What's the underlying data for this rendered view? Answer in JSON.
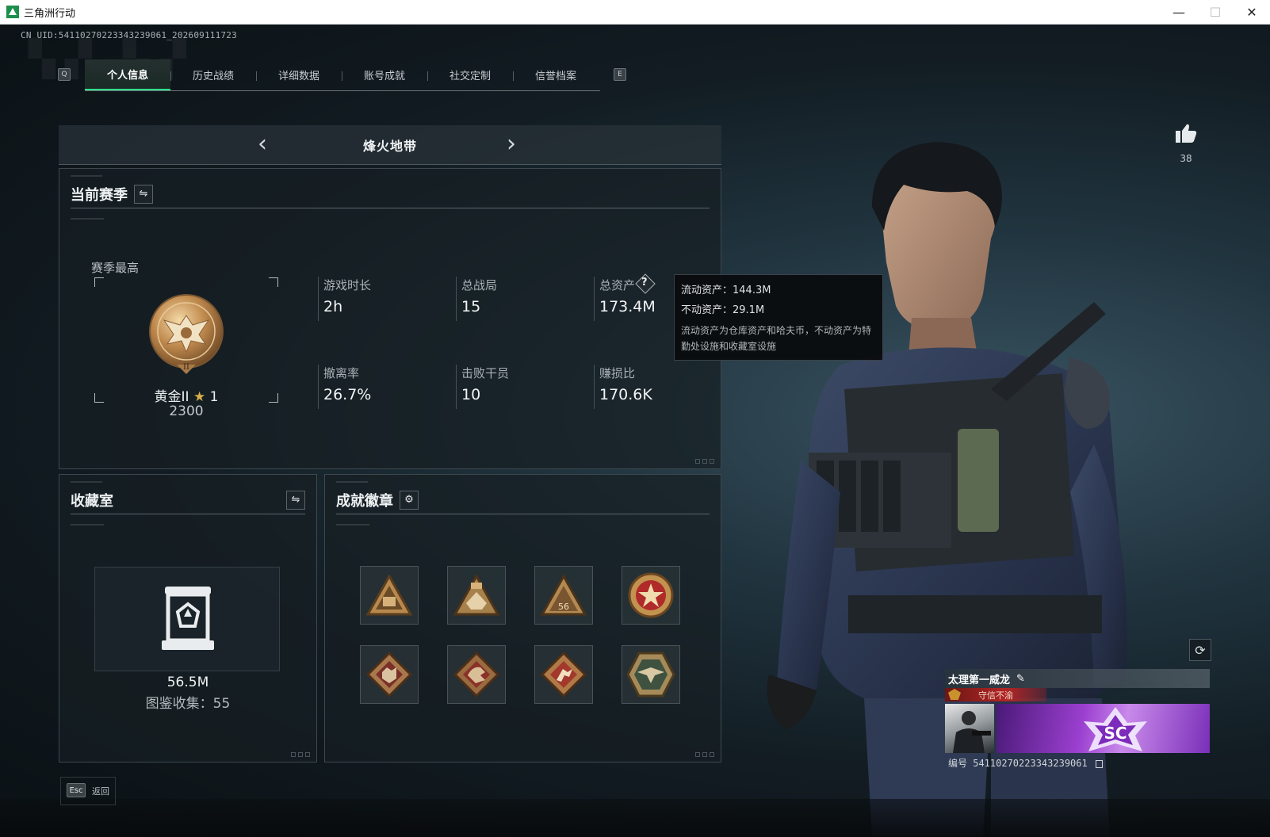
{
  "window": {
    "title": "三角洲行动",
    "minimize": "—",
    "maximize": "☐",
    "close": "✕"
  },
  "uid_text": "CN UID:541102702233432390​61_202609111723",
  "tabs": {
    "left_key": "Q",
    "right_key": "E",
    "items": [
      "个人信息",
      "历史战绩",
      "详细数据",
      "账号成就",
      "社交定制",
      "信誉档案"
    ],
    "active_index": 0
  },
  "mode": {
    "title": "烽火地带",
    "prev": "‹",
    "next": "›"
  },
  "season": {
    "title": "当前赛季",
    "best_label": "赛季最高",
    "rank_name": "黄金II",
    "rank_star": "★",
    "rank_star_count": "1",
    "rank_score": "2300",
    "stats": [
      {
        "label": "游戏时长",
        "value": "2h"
      },
      {
        "label": "总战局",
        "value": "15"
      },
      {
        "label": "总资产",
        "value": "173.4M"
      },
      {
        "label": "撤离率",
        "value": "26.7%"
      },
      {
        "label": "击败干员",
        "value": "10"
      },
      {
        "label": "赚损比",
        "value": "170.6K"
      }
    ],
    "help": "?"
  },
  "tooltip": {
    "liquid": "流动资产：144.3M",
    "fixed": "不动资产：29.1M",
    "note": "流动资产为仓库资产和哈夫币，不动资产为特勤处设施和收藏室设施"
  },
  "collection": {
    "title": "收藏室",
    "value": "56.5M",
    "count_text": "图鉴收集：55"
  },
  "achievements": {
    "title": "成就徽章",
    "badge_icons": [
      "triangle-tank-badge",
      "triangle-crown-badge",
      "triangle-56-badge",
      "star-medal-badge",
      "diamond-wolf-badge",
      "diamond-dragon-badge",
      "diamond-runner-badge",
      "hexagon-eagle-badge"
    ],
    "badge_text_56": "56"
  },
  "profile": {
    "like_count": "38",
    "player_name": "太理第一威龙",
    "edit_icon": "✎",
    "tag": "守信不渝",
    "id_text": "编号 541102702233432390​61",
    "refresh_icon": "⟳"
  },
  "footer": {
    "esc_key": "Esc",
    "back_label": "返回"
  },
  "colors": {
    "accent": "#2ee08c",
    "gold": "#d8b04a",
    "badge_red": "#b22525",
    "banner_purple": "#9b3fd0"
  }
}
